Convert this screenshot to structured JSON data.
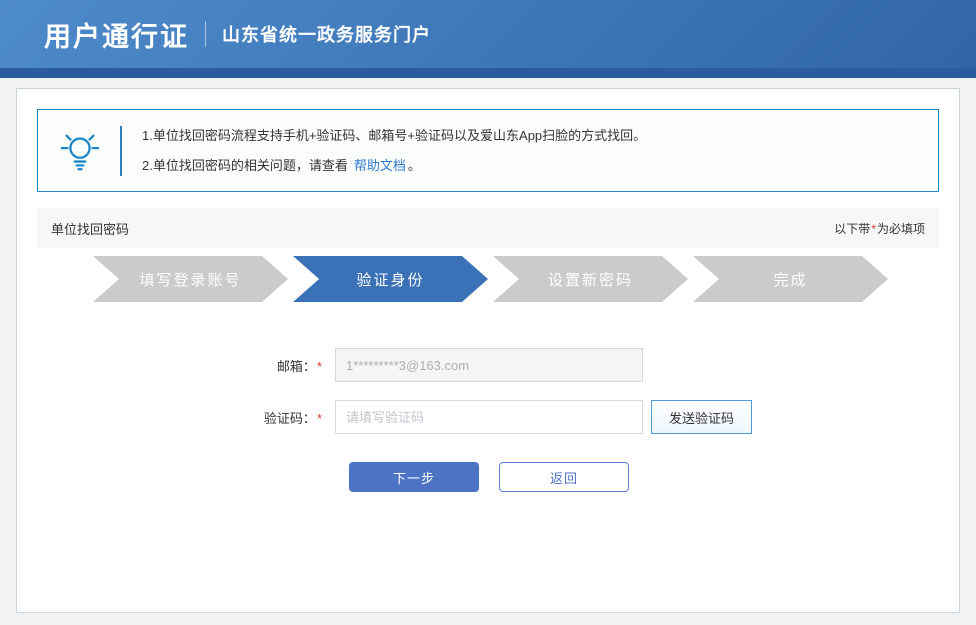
{
  "header": {
    "title": "用户通行证",
    "subtitle": "山东省统一政务服务门户"
  },
  "tips": {
    "lightbulb_icon": "lightbulb-icon",
    "line1": "1.单位找回密码流程支持手机+验证码、邮箱号+验证码以及爱山东App扫脸的方式找回。",
    "line2_prefix": "2.单位找回密码的相关问题，请查看",
    "line2_link": "帮助文档",
    "line2_suffix": "。"
  },
  "section": {
    "title": "单位找回密码",
    "required_note_prefix": "以下带",
    "required_star": "*",
    "required_note_suffix": "为必填项"
  },
  "wizard": {
    "steps": [
      {
        "label": "填写登录账号",
        "state": "done"
      },
      {
        "label": "验证身份",
        "state": "active"
      },
      {
        "label": "设置新密码",
        "state": "pending"
      },
      {
        "label": "完成",
        "state": "pending"
      }
    ]
  },
  "form": {
    "email": {
      "label": "邮箱：",
      "required_star": "*",
      "value": "1*********3@163.com"
    },
    "code": {
      "label": "验证码：",
      "required_star": "*",
      "placeholder": "请填写验证码",
      "send_button_label": "发送验证码"
    },
    "next_button_label": "下一步",
    "back_button_label": "返回"
  },
  "colors": {
    "header_gradient_start": "#4e8bcb",
    "header_gradient_end": "#3065a6",
    "header_strip": "#2b5c9d",
    "tip_border_blue": "#1f86c8",
    "link_blue": "#2f7bd0",
    "active_step_blue": "#3b72b7",
    "step_gray": "#cbcbcb",
    "primary_button_blue": "#4d73c4",
    "required_red": "#e23a3a",
    "section_band_gray": "#f7f7f7"
  }
}
